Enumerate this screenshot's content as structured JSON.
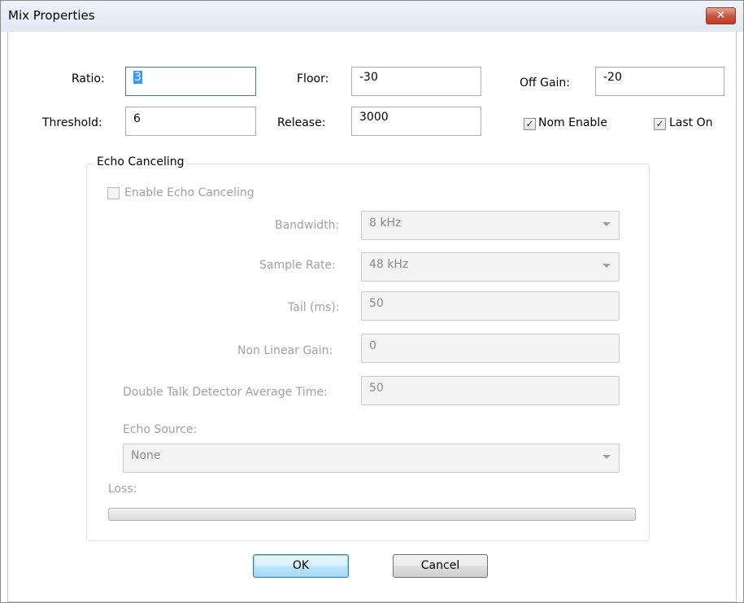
{
  "window": {
    "title": "Mix Properties",
    "close_symbol": "✕"
  },
  "mix": {
    "ratio_label": "Ratio:",
    "ratio_value": "3",
    "threshold_label": "Threshold:",
    "threshold_value": "6",
    "floor_label": "Floor:",
    "floor_value": "-30",
    "release_label": "Release:",
    "release_value": "3000",
    "off_gain_label": "Off Gain:",
    "off_gain_value": "-20",
    "nom_enable_label": "Nom Enable",
    "nom_enable_checked": true,
    "last_on_label": "Last On",
    "last_on_checked": true
  },
  "echo": {
    "group_title": "Echo Canceling",
    "enable_label": "Enable Echo Canceling",
    "enable_checked": false,
    "bandwidth_label": "Bandwidth:",
    "bandwidth_value": "8 kHz",
    "sample_rate_label": "Sample Rate:",
    "sample_rate_value": "48 kHz",
    "tail_label": "Tail (ms):",
    "tail_value": "50",
    "nlg_label": "Non Linear Gain:",
    "nlg_value": "0",
    "dtd_label": "Double Talk Detector Average Time:",
    "dtd_value": "50",
    "echo_source_label": "Echo Source:",
    "echo_source_value": "None",
    "loss_label": "Loss:",
    "loss_progress": 0
  },
  "buttons": {
    "ok": "OK",
    "cancel": "Cancel"
  },
  "icons": {
    "checkmark": "✓",
    "dropdown": "chevron-down-icon"
  },
  "colors": {
    "selection": "#3399ff",
    "close_button": "#c8553f",
    "disabled_text": "#a0a0a0"
  }
}
